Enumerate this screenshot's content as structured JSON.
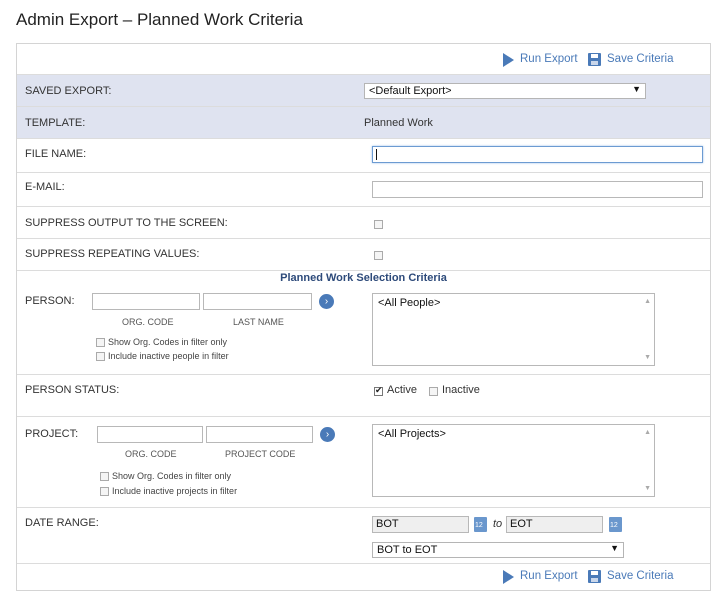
{
  "page": {
    "title": "Admin Export – Planned Work Criteria"
  },
  "toolbar": {
    "run_label": "Run Export",
    "save_label": "Save Criteria"
  },
  "saved_export": {
    "label": "SAVED EXPORT:",
    "value": "<Default Export>"
  },
  "template": {
    "label": "TEMPLATE:",
    "value": "Planned Work"
  },
  "file_name": {
    "label": "FILE NAME:",
    "value": ""
  },
  "email": {
    "label": "E-MAIL:",
    "value": ""
  },
  "suppress_output": {
    "label": "SUPPRESS OUTPUT TO THE SCREEN:",
    "checked": false
  },
  "suppress_repeating": {
    "label": "SUPPRESS REPEATING VALUES:",
    "checked": false
  },
  "section": {
    "title": "Planned Work Selection Criteria"
  },
  "person": {
    "label": "PERSON:",
    "org_code_caption": "ORG. CODE",
    "last_name_caption": "LAST NAME",
    "show_org_codes": "Show Org. Codes in filter only",
    "include_inactive": "Include inactive people in filter",
    "list_item": "<All People>"
  },
  "person_status": {
    "label": "PERSON STATUS:",
    "active": "Active",
    "inactive": "Inactive",
    "active_checked": true,
    "inactive_checked": false
  },
  "project": {
    "label": "PROJECT:",
    "org_code_caption": "ORG. CODE",
    "project_code_caption": "PROJECT CODE",
    "show_org_codes": "Show Org. Codes in filter only",
    "include_inactive": "Include inactive projects in filter",
    "list_item": "<All Projects>"
  },
  "date_range": {
    "label": "DATE RANGE:",
    "from": "BOT",
    "to_word": "to",
    "to": "EOT",
    "preset": "BOT to EOT"
  },
  "colors": {
    "accent": "#4a7ab8",
    "shaded_row": "#dfe3f0",
    "section_text": "#2d4a7a"
  }
}
